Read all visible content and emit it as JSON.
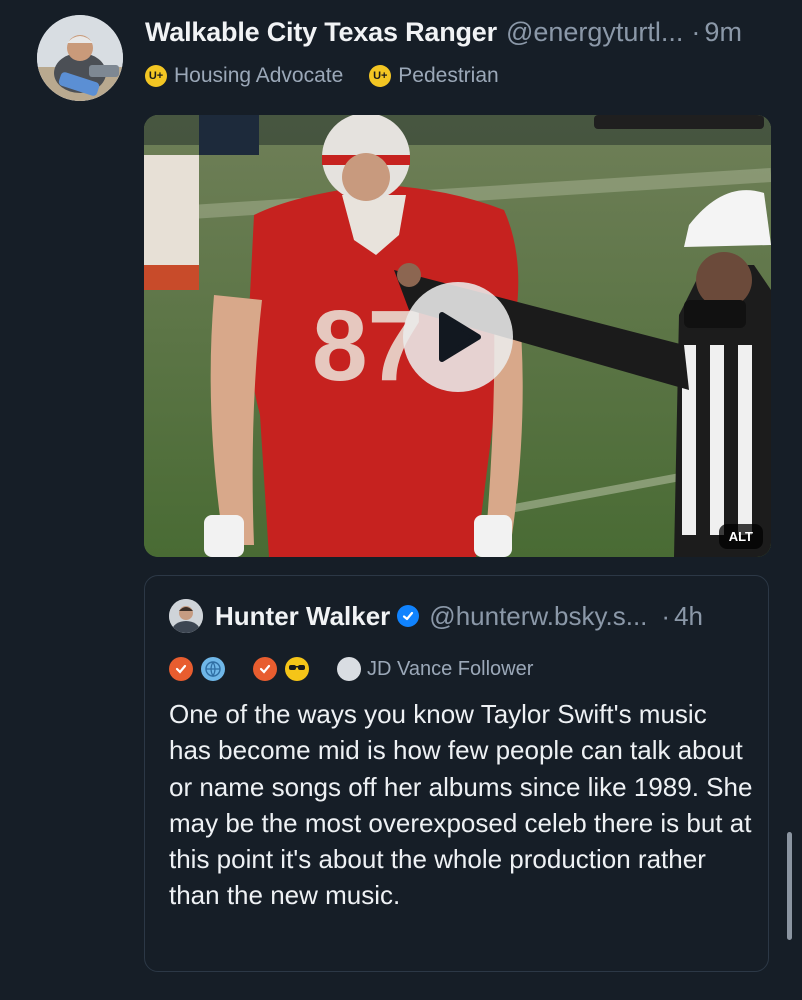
{
  "post": {
    "author_name": "Walkable City Texas Ranger",
    "author_handle": "@energyturtl...",
    "separator": "·",
    "time": "9m",
    "badges": [
      {
        "icon": "U+",
        "label": "Housing Advocate"
      },
      {
        "icon": "U+",
        "label": "Pedestrian"
      }
    ],
    "media": {
      "alt_label": "ALT",
      "play_icon": "play-icon"
    }
  },
  "quote": {
    "author_name": "Hunter Walker",
    "author_handle": "@hunterw.bsky.s...",
    "separator": "·",
    "time": "4h",
    "badge_label": "JD Vance Follower",
    "text": "One of the ways you know Taylor Swift's music has become mid is how few people can talk about or name songs off her albums since like 1989. She may be the most overexposed celeb there is but at this point it's about the whole production rather than the new music."
  },
  "colors": {
    "background": "#161e27",
    "muted_text": "#8b98a8",
    "verified_blue": "#1083fe",
    "badge_yellow": "#f3c623"
  }
}
